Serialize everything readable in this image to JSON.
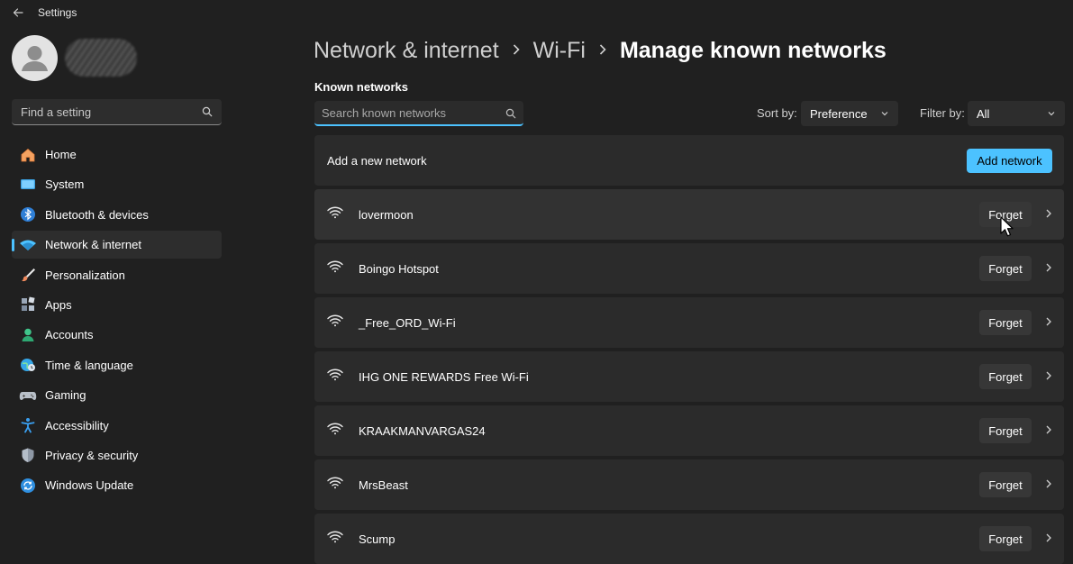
{
  "window": {
    "title": "Settings"
  },
  "sidebar": {
    "search_placeholder": "Find a setting",
    "items": [
      {
        "label": "Home",
        "icon": "home-icon"
      },
      {
        "label": "System",
        "icon": "monitor-icon"
      },
      {
        "label": "Bluetooth & devices",
        "icon": "bluetooth-icon"
      },
      {
        "label": "Network & internet",
        "icon": "wifi-icon",
        "active": true
      },
      {
        "label": "Personalization",
        "icon": "brush-icon"
      },
      {
        "label": "Apps",
        "icon": "apps-icon"
      },
      {
        "label": "Accounts",
        "icon": "person-icon"
      },
      {
        "label": "Time & language",
        "icon": "globe-clock-icon"
      },
      {
        "label": "Gaming",
        "icon": "gamepad-icon"
      },
      {
        "label": "Accessibility",
        "icon": "accessibility-icon"
      },
      {
        "label": "Privacy & security",
        "icon": "shield-icon"
      },
      {
        "label": "Windows Update",
        "icon": "update-icon"
      }
    ]
  },
  "breadcrumb": {
    "parts": [
      "Network & internet",
      "Wi-Fi"
    ],
    "current": "Manage known networks"
  },
  "known_networks": {
    "section_label": "Known networks",
    "search_placeholder": "Search known networks",
    "sort_label": "Sort by:",
    "sort_value": "Preference",
    "filter_label": "Filter by:",
    "filter_value": "All",
    "add_row_label": "Add a new network",
    "add_button_label": "Add network",
    "forget_label": "Forget",
    "networks": [
      {
        "name": "lovermoon"
      },
      {
        "name": "Boingo Hotspot"
      },
      {
        "name": "_Free_ORD_Wi-Fi"
      },
      {
        "name": "IHG ONE REWARDS Free Wi-Fi"
      },
      {
        "name": "KRAAKMANVARGAS24"
      },
      {
        "name": "MrsBeast"
      },
      {
        "name": "Scump"
      }
    ]
  },
  "colors": {
    "background": "#202020",
    "card": "#2b2b2b",
    "accent": "#4cc2ff"
  }
}
